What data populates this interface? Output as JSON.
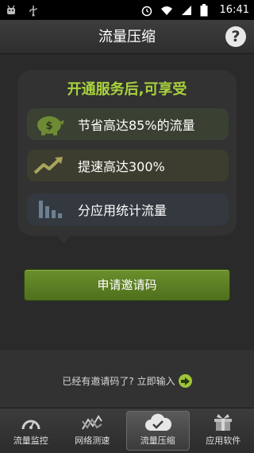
{
  "status_bar": {
    "time": "16:41",
    "icons": [
      "android-debug-icon",
      "usb-icon",
      "alarm-icon",
      "wifi-icon",
      "signal-icon",
      "battery-icon"
    ]
  },
  "header": {
    "title": "流量压缩",
    "help_label": "?"
  },
  "promo": {
    "title": "开通服务后,可享受",
    "features": [
      {
        "icon": "piggy-bank-icon",
        "label": "节省高达85%的流量"
      },
      {
        "icon": "trend-up-icon",
        "label": "提速高达300%"
      },
      {
        "icon": "bar-chart-icon",
        "label": "分应用统计流量"
      }
    ]
  },
  "apply_button": {
    "label": "申请邀请码"
  },
  "invite": {
    "text": "已经有邀请码了? 立即输入"
  },
  "tabs": [
    {
      "label": "流量监控",
      "icon": "gauge-icon",
      "active": false
    },
    {
      "label": "网络测速",
      "icon": "speed-chart-icon",
      "active": false
    },
    {
      "label": "流量压缩",
      "icon": "cloud-check-icon",
      "active": true
    },
    {
      "label": "应用软件",
      "icon": "gift-box-icon",
      "active": false
    }
  ],
  "colors": {
    "accent_green": "#a9d33d",
    "button_green": "#5c7f24",
    "background": "#2a2a2a"
  }
}
